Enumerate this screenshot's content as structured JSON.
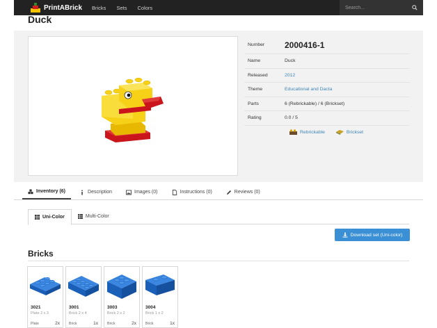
{
  "navbar": {
    "brand": "PrintABrick",
    "links": [
      "Bricks",
      "Sets",
      "Colors"
    ],
    "search_placeholder": "Search..."
  },
  "page": {
    "title": "Duck"
  },
  "details": {
    "number_label": "Number",
    "number": "2000416-1",
    "name_label": "Name",
    "name": "Duck",
    "released_label": "Released",
    "released": "2012",
    "theme_label": "Theme",
    "theme": "Educational and Dacta",
    "parts_label": "Parts",
    "parts": "6 (Rebrickable) / 6 (Brickset)",
    "rating_label": "Rating",
    "rating": "0.0 / 5",
    "links": [
      {
        "label": "Rebrickable",
        "icon": "rebrickable-icon"
      },
      {
        "label": "Brickset",
        "icon": "brickset-icon"
      }
    ]
  },
  "tabs": [
    {
      "label": "Inventory (6)",
      "icon": "cubes-icon",
      "active": true
    },
    {
      "label": "Description",
      "icon": "info-icon"
    },
    {
      "label": "Images (0)",
      "icon": "image-icon"
    },
    {
      "label": "Instructions (0)",
      "icon": "file-icon"
    },
    {
      "label": "Reviews (0)",
      "icon": "pencil-icon"
    }
  ],
  "subtabs": [
    {
      "label": "Uni-Color",
      "icon": "grid-icon",
      "active": true
    },
    {
      "label": "Multi-Color",
      "icon": "grid-icon"
    }
  ],
  "download_button": "Download set (Uni-color)",
  "bricks_section": {
    "title": "Bricks",
    "items": [
      {
        "number": "3021",
        "name": "Plate 2 x 3",
        "category": "Plate",
        "qty": "2x"
      },
      {
        "number": "3001",
        "name": "Brick 2 x 4",
        "category": "Brick",
        "qty": "1x"
      },
      {
        "number": "3003",
        "name": "Brick 2 x 2",
        "category": "Brick",
        "qty": "2x"
      },
      {
        "number": "3004",
        "name": "Brick 1 x 2",
        "category": "Brick",
        "qty": "1x"
      }
    ]
  },
  "colors": {
    "navbar_bg": "#222222",
    "accent_blue": "#3b8fd4",
    "link_blue": "#3d84b8",
    "brick_blue": "#1e6fd0",
    "duck_yellow": "#f7d117",
    "duck_red": "#c9151b"
  }
}
